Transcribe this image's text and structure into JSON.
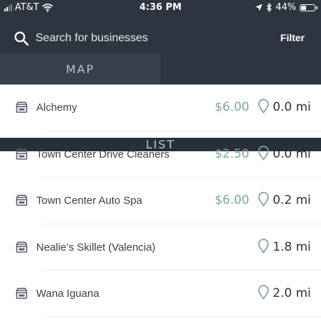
{
  "status_bar": {
    "carrier": "AT&T",
    "time": "4:36 PM",
    "battery_percent_label": "44%",
    "battery_level": 0.44,
    "icons": [
      "signal-icon",
      "wifi-icon",
      "location-arrow-icon",
      "bluetooth-icon",
      "battery-icon"
    ]
  },
  "search": {
    "placeholder": "Search for businesses",
    "value": "",
    "icon": "search-icon"
  },
  "filter": {
    "label": "Filter"
  },
  "tabs": [
    {
      "label": "MAP",
      "active": false
    },
    {
      "label": "LIST",
      "active": true
    }
  ],
  "colors": {
    "header_bg": "#2e3540",
    "price": "#7fa79b",
    "pin": "#7fa79b",
    "store_icon": "#5b6270"
  },
  "businesses": [
    {
      "name": "Alchemy",
      "price": "$6.00",
      "distance": "0.0 mi"
    },
    {
      "name": "Town Center Drive Cleaners",
      "price": "$2.50",
      "distance": "0.0 mi"
    },
    {
      "name": "Town Center Auto Spa",
      "price": "$6.00",
      "distance": "0.2 mi"
    },
    {
      "name": "Nealie’s Skillet (Valencia)",
      "price": "",
      "distance": "1.8 mi"
    },
    {
      "name": "Wana Iguana",
      "price": "",
      "distance": "2.0 mi"
    }
  ]
}
